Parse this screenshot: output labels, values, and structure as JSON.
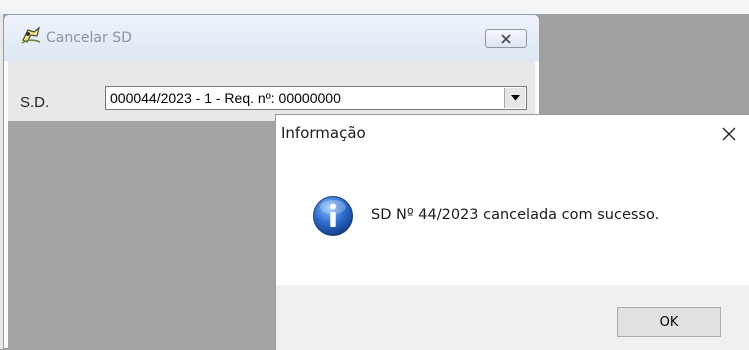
{
  "window": {
    "title": "Cancelar SD",
    "icon": "app-icon",
    "close_icon": "close-icon"
  },
  "form": {
    "sd_label": "S.D.",
    "sd_value": "000044/2023 - 1  - Req. nº: 00000000",
    "dropdown_icon": "chevron-down-icon"
  },
  "dialog": {
    "title": "Informação",
    "message": "SD Nº 44/2023 cancelada com sucesso.",
    "ok_label": "OK",
    "icon": "info-icon",
    "close_glyph": "✕"
  },
  "colors": {
    "info_blue": "#2f6fd1",
    "mdi_background": "#a0a0a0",
    "dialog_footer": "#f0f0f0"
  }
}
